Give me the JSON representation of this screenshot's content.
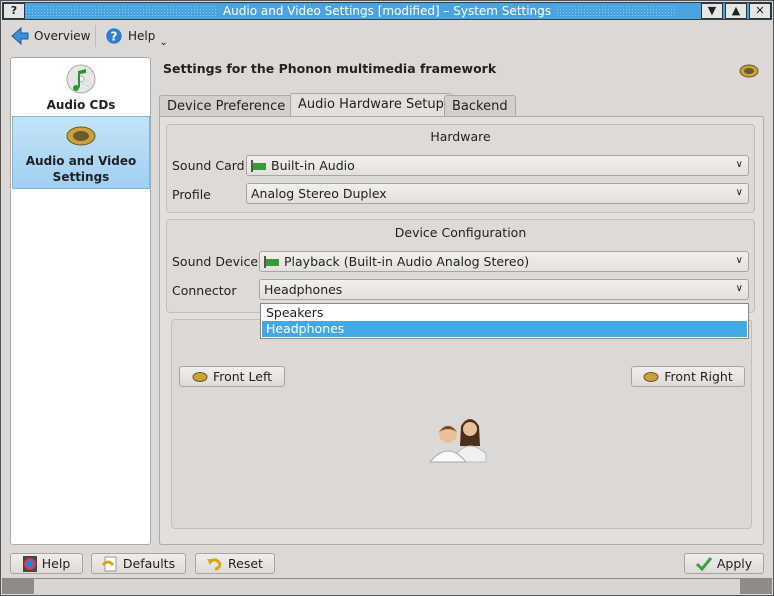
{
  "window": {
    "title": "Audio and Video Settings [modified] – System Settings",
    "help_btn": "?",
    "buttons": [
      "▼",
      "▲",
      "✕"
    ]
  },
  "toolbar": {
    "overview": "Overview",
    "help": "Help",
    "help_menu": "⌄"
  },
  "sidebar": {
    "items": [
      {
        "label": "Audio CDs",
        "icon": "cd-music-icon",
        "selected": false
      },
      {
        "label": "Audio and Video Settings",
        "icon": "speaker-icon",
        "selected": true
      }
    ]
  },
  "main": {
    "heading": "Settings for the Phonon multimedia framework",
    "tabs": [
      {
        "label": "Device Preference",
        "active": false
      },
      {
        "label": "Audio Hardware Setup",
        "active": true
      },
      {
        "label": "Backend",
        "active": false
      }
    ],
    "hardware": {
      "title": "Hardware",
      "sound_card_label": "Sound Card",
      "sound_card_value": "Built-in Audio",
      "profile_label": "Profile",
      "profile_value": "Analog Stereo Duplex"
    },
    "device_config": {
      "title": "Device Configuration",
      "sound_device_label": "Sound Device",
      "sound_device_value": "Playback (Built-in Audio Analog Stereo)",
      "connector_label": "Connector",
      "connector_value": "Headphones"
    },
    "connector_options": [
      {
        "label": "Speakers",
        "highlighted": false
      },
      {
        "label": "Headphones",
        "highlighted": true
      }
    ],
    "speakers": {
      "front_left": "Front Left",
      "front_right": "Front Right"
    }
  },
  "footer": {
    "help": "Help",
    "defaults": "Defaults",
    "reset": "Reset",
    "apply": "Apply"
  },
  "colors": {
    "titlebar": "#4aa3df",
    "highlight": "#42a9e5",
    "selection": "#9fd0f2"
  }
}
